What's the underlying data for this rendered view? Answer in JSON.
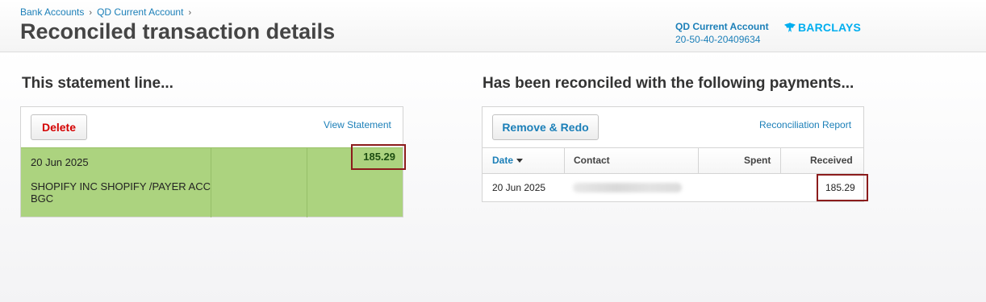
{
  "breadcrumb": {
    "items": [
      "Bank Accounts",
      "QD Current Account"
    ],
    "separator": "›"
  },
  "page_title": "Reconciled transaction details",
  "account": {
    "name": "QD Current Account",
    "number": "20-50-40-20409634",
    "bank_logo_text": "BARCLAYS",
    "bank_logo_icon": "eagle-icon",
    "bank_color": "#00aeef"
  },
  "statement_section": {
    "heading": "This statement line...",
    "delete_label": "Delete",
    "view_statement_label": "View Statement",
    "line": {
      "date": "20 Jun 2025",
      "description": "SHOPIFY INC SHOPIFY /PAYER ACC BGC",
      "amount": "185.29"
    }
  },
  "payments_section": {
    "heading": "Has been reconciled with the following payments...",
    "remove_redo_label": "Remove & Redo",
    "report_label": "Reconciliation Report",
    "columns": [
      "Date",
      "Contact",
      "Spent",
      "Received"
    ],
    "rows": [
      {
        "date": "20 Jun 2025",
        "contact": "",
        "spent": "",
        "received": "185.29"
      }
    ]
  },
  "colors": {
    "link": "#1b7fb8",
    "statement_green": "#acd37f",
    "delete_red": "#d40000",
    "highlight_border": "#8b1c1c"
  }
}
